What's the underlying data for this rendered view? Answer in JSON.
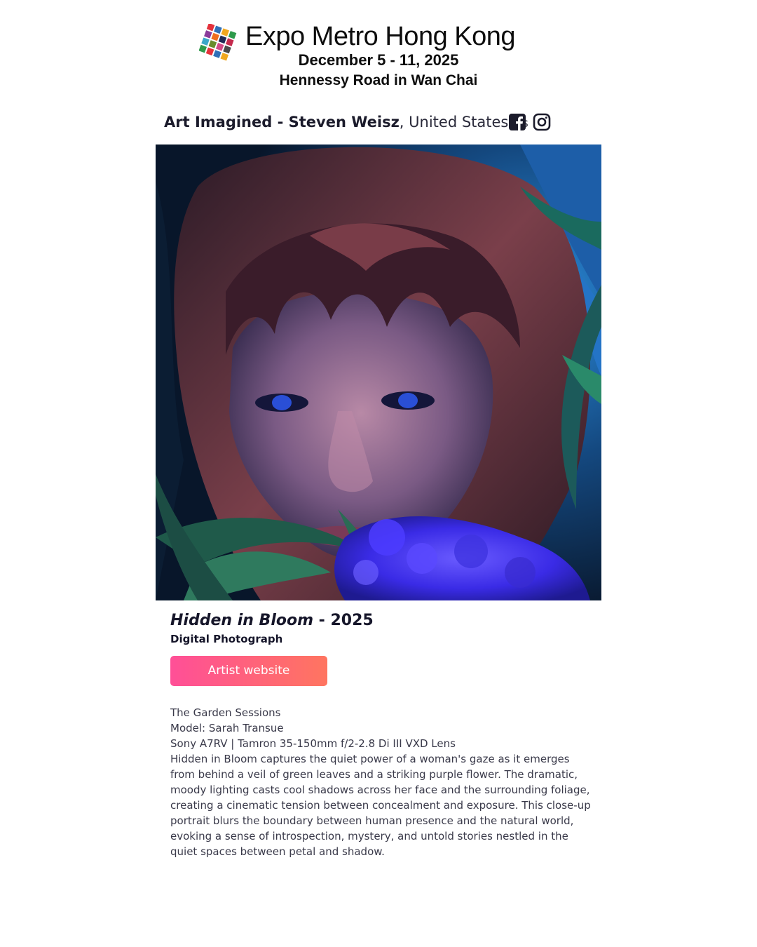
{
  "header": {
    "title": "Expo Metro Hong Kong",
    "dates": "December 5 - 11, 2025",
    "location": "Hennessy Road in Wan Chai",
    "logo_colors": [
      "#e4313b",
      "#2f6fb7",
      "#f1a81f",
      "#2e9a4b",
      "#8a3b9b",
      "#f06e1f",
      "#1f2a55",
      "#c42a4d",
      "#3aa7c9",
      "#6a8c2c",
      "#d34b87",
      "#4b4b4b"
    ]
  },
  "artist": {
    "name": "Art Imagined - Steven Weisz",
    "country": ", United States",
    "country_code": "us",
    "social": [
      {
        "icon": "facebook-icon"
      },
      {
        "icon": "instagram-icon"
      }
    ]
  },
  "artwork": {
    "title": "Hidden in Bloom",
    "year_sep": " - 2025",
    "medium": "Digital Photograph",
    "button_label": "Artist website"
  },
  "description": {
    "series": "The Garden Sessions",
    "model": "Model: Sarah Transue",
    "gear": "Sony A7RV | Tamron 35-150mm f/2-2.8 Di III VXD Lens",
    "body": "Hidden in Bloom captures the quiet power of a woman's gaze as it emerges from behind a veil of green leaves and a striking purple flower. The dramatic, moody lighting casts cool shadows across her face and the surrounding foliage, creating a cinematic tension between concealment and exposure. This close-up portrait blurs the boundary between human presence and the natural world, evoking a sense of introspection, mystery, and untold stories nestled in the quiet spaces between petal and shadow."
  },
  "colors": {
    "button_start": "#ff4f97",
    "button_end": "#ff7560",
    "text_dark": "#16162a"
  }
}
